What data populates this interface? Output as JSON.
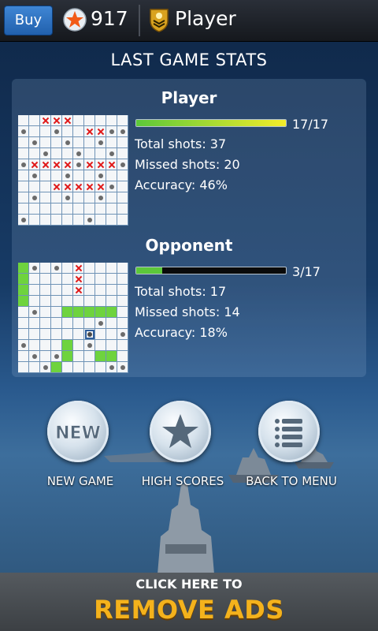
{
  "topbar": {
    "buy_label": "Buy",
    "points": "917",
    "player_name": "Player"
  },
  "title": "LAST GAME STATS",
  "player": {
    "name": "Player",
    "progress_text": "17/17",
    "progress_fraction": 1.0,
    "bar_colors": [
      "#5cc83a",
      "#f3ec2a"
    ],
    "total_shots": "Total shots: 37",
    "missed_shots": "Missed shots: 20",
    "accuracy": "Accuracy: 46%",
    "grid": [
      "..XXX.....",
      "M..M..XXMM",
      ".M..M..M..",
      "..M..M..M.",
      "MXXXXMXXXM",
      ".M..M..M..",
      "...XXXXXM.",
      ".M..M..M..",
      "..........",
      "M.....M..."
    ]
  },
  "opponent": {
    "name": "Opponent",
    "progress_text": "3/17",
    "progress_fraction": 0.176,
    "bar_colors": [
      "#5cc83a",
      "#5cc83a"
    ],
    "total_shots": "Total shots: 17",
    "missed_shots": "Missed shots: 14",
    "accuracy": "Accuracy: 18%",
    "grid": [
      "SM.M.X....",
      "S....X....",
      "S....X....",
      "S.........",
      ".M..SSSSS.",
      ".......M..",
      "......P..M",
      "M...S.M...",
      ".M.MS..SS.",
      "..MS....MM"
    ]
  },
  "buttons": {
    "new_game": "NEW GAME",
    "new_icon_text": "NEW",
    "high_scores": "HIGH SCORES",
    "back_to_menu": "BACK TO MENU"
  },
  "ad": {
    "line1": "CLICK HERE TO",
    "line2": "REMOVE ADS"
  },
  "icons": [
    "star-icon",
    "rank-badge-icon",
    "star-button-icon",
    "menu-list-icon"
  ]
}
